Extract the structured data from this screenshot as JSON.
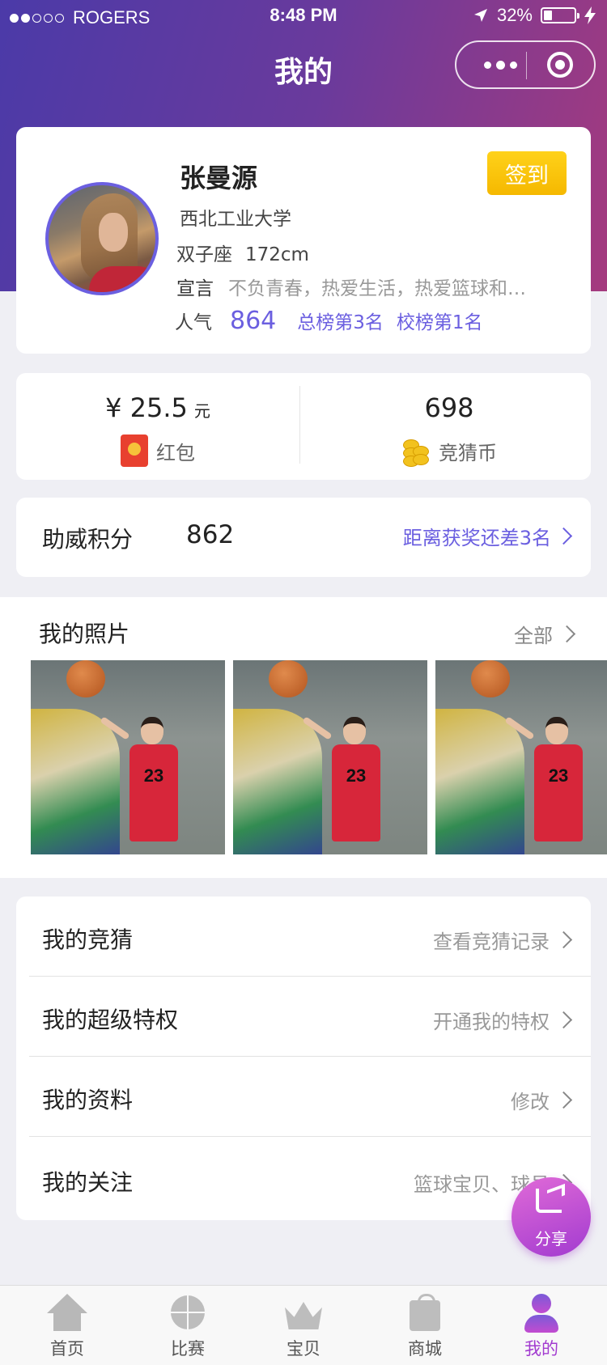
{
  "status_bar": {
    "carrier": "ROGERS",
    "time": "8:48 PM",
    "battery": "32%",
    "signal_dots_filled": 2,
    "signal_dots_total": 5,
    "battery_level": 0.32
  },
  "nav": {
    "title": "我的"
  },
  "profile": {
    "name": "张曼源",
    "school": "西北工业大学",
    "zodiac": "双子座",
    "height": "172cm",
    "motto_label": "宣言",
    "motto": "不负青春，热爱生活，热爱篮球和…",
    "popularity_label": "人气",
    "popularity": "864",
    "rank_total": "总榜第3名",
    "rank_school": "校榜第1名",
    "checkin_label": "签到"
  },
  "wallet": {
    "money_prefix": "¥",
    "money": "25.5",
    "money_unit": "元",
    "redpack_label": "红包",
    "coins": "698",
    "coins_label": "竞猜币"
  },
  "points": {
    "label": "助威积分",
    "value": "862",
    "link": "距离获奖还差3名"
  },
  "photos": {
    "title": "我的照片",
    "all_label": "全部",
    "jersey_text": "23",
    "count": 3
  },
  "menu": {
    "items": [
      {
        "label": "我的竞猜",
        "action": "查看竞猜记录"
      },
      {
        "label": "我的超级特权",
        "action": "开通我的特权"
      },
      {
        "label": "我的资料",
        "action": "修改"
      },
      {
        "label": "我的关注",
        "action": "篮球宝贝、球员"
      }
    ]
  },
  "share": {
    "label": "分享"
  },
  "tabbar": {
    "tabs": [
      {
        "label": "首页",
        "icon": "home-icon"
      },
      {
        "label": "比赛",
        "icon": "basketball-icon"
      },
      {
        "label": "宝贝",
        "icon": "crown-icon"
      },
      {
        "label": "商城",
        "icon": "shopping-bag-icon"
      },
      {
        "label": "我的",
        "icon": "user-icon"
      }
    ],
    "active_index": 4
  },
  "colors": {
    "accent": "#6b5fe0",
    "checkin": "#f5b800",
    "active_tab": "#a23bd0",
    "header_start": "#4b3aa8",
    "header_end": "#a53a7e"
  }
}
